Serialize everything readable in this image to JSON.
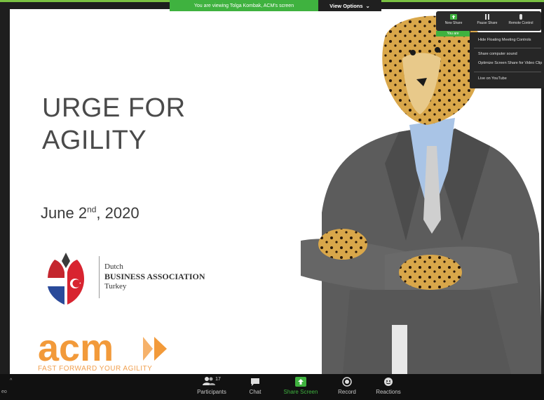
{
  "banner": {
    "viewing_text": "You are viewing Tolga Kombak, ACM's screen",
    "view_options": "View Options",
    "view_options_caret": "⌄"
  },
  "slide": {
    "title_line1": "URGE FOR",
    "title_line2": "AGILITY",
    "date_prefix": "June 2",
    "date_suffix": "nd",
    "date_rest": ",  2020",
    "dba": {
      "line1": "Dutch",
      "line2": "BUSINESS ASSOCIATION",
      "line3": "Turkey"
    },
    "acm": {
      "wordmark": "acm",
      "tagline": "FAST FORWARD YOUR AGILITY"
    }
  },
  "floating_controls": {
    "buttons": [
      "New Share",
      "Pause Share",
      "Remote Control"
    ],
    "status": "You are",
    "menu": [
      "Hide Floating Meeting Controls",
      "Share computer sound",
      "Optimize Screen Share for Video Clip",
      "Live on YouTube"
    ]
  },
  "toolbar": {
    "left_text": "eo",
    "caret": "^",
    "participants_count": "17",
    "items": [
      "Participants",
      "Chat",
      "Share Screen",
      "Record",
      "Reactions"
    ]
  },
  "colors": {
    "zoom_green": "#3fb23f",
    "acm_orange": "#f29a3a",
    "toolbar_bg": "#111111"
  }
}
